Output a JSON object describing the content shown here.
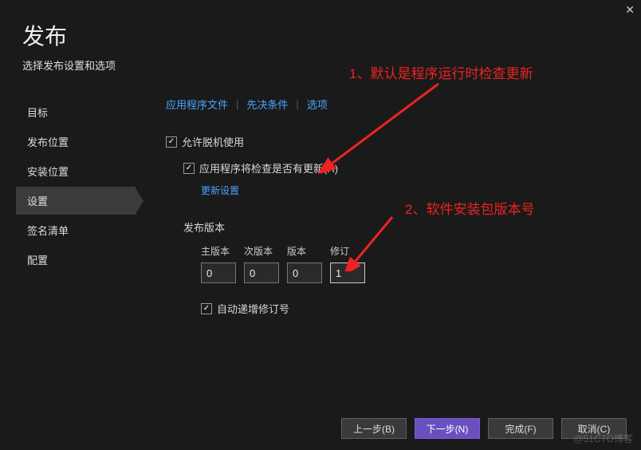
{
  "window": {
    "title": "发布",
    "subtitle": "选择发布设置和选项"
  },
  "sidebar": {
    "items": [
      {
        "label": "目标",
        "active": false
      },
      {
        "label": "发布位置",
        "active": false
      },
      {
        "label": "安装位置",
        "active": false
      },
      {
        "label": "设置",
        "active": true
      },
      {
        "label": "签名清单",
        "active": false
      },
      {
        "label": "配置",
        "active": false
      }
    ]
  },
  "subnav": {
    "files": "应用程序文件",
    "prereq": "先决条件",
    "options": "选项"
  },
  "settings": {
    "allow_offline": {
      "label": "允许脱机使用",
      "checked": true
    },
    "check_updates": {
      "label": "应用程序将检查是否有更新(H)",
      "checked": true
    },
    "update_settings_link": "更新设置",
    "publish_version_label": "发布版本",
    "version_columns": {
      "major": {
        "label": "主版本",
        "value": "0"
      },
      "minor": {
        "label": "次版本",
        "value": "0"
      },
      "build": {
        "label": "版本",
        "value": "0"
      },
      "revision": {
        "label": "修订",
        "value": "1"
      }
    },
    "auto_increment": {
      "label": "自动递增修订号",
      "checked": true
    }
  },
  "footer": {
    "back": "上一步(B)",
    "next": "下一步(N)",
    "finish": "完成(F)",
    "cancel": "取消(C)"
  },
  "annotations": {
    "note1": "1、默认是程序运行时检查更新",
    "note2": "2、软件安装包版本号"
  },
  "watermark": "@51CTO博客"
}
